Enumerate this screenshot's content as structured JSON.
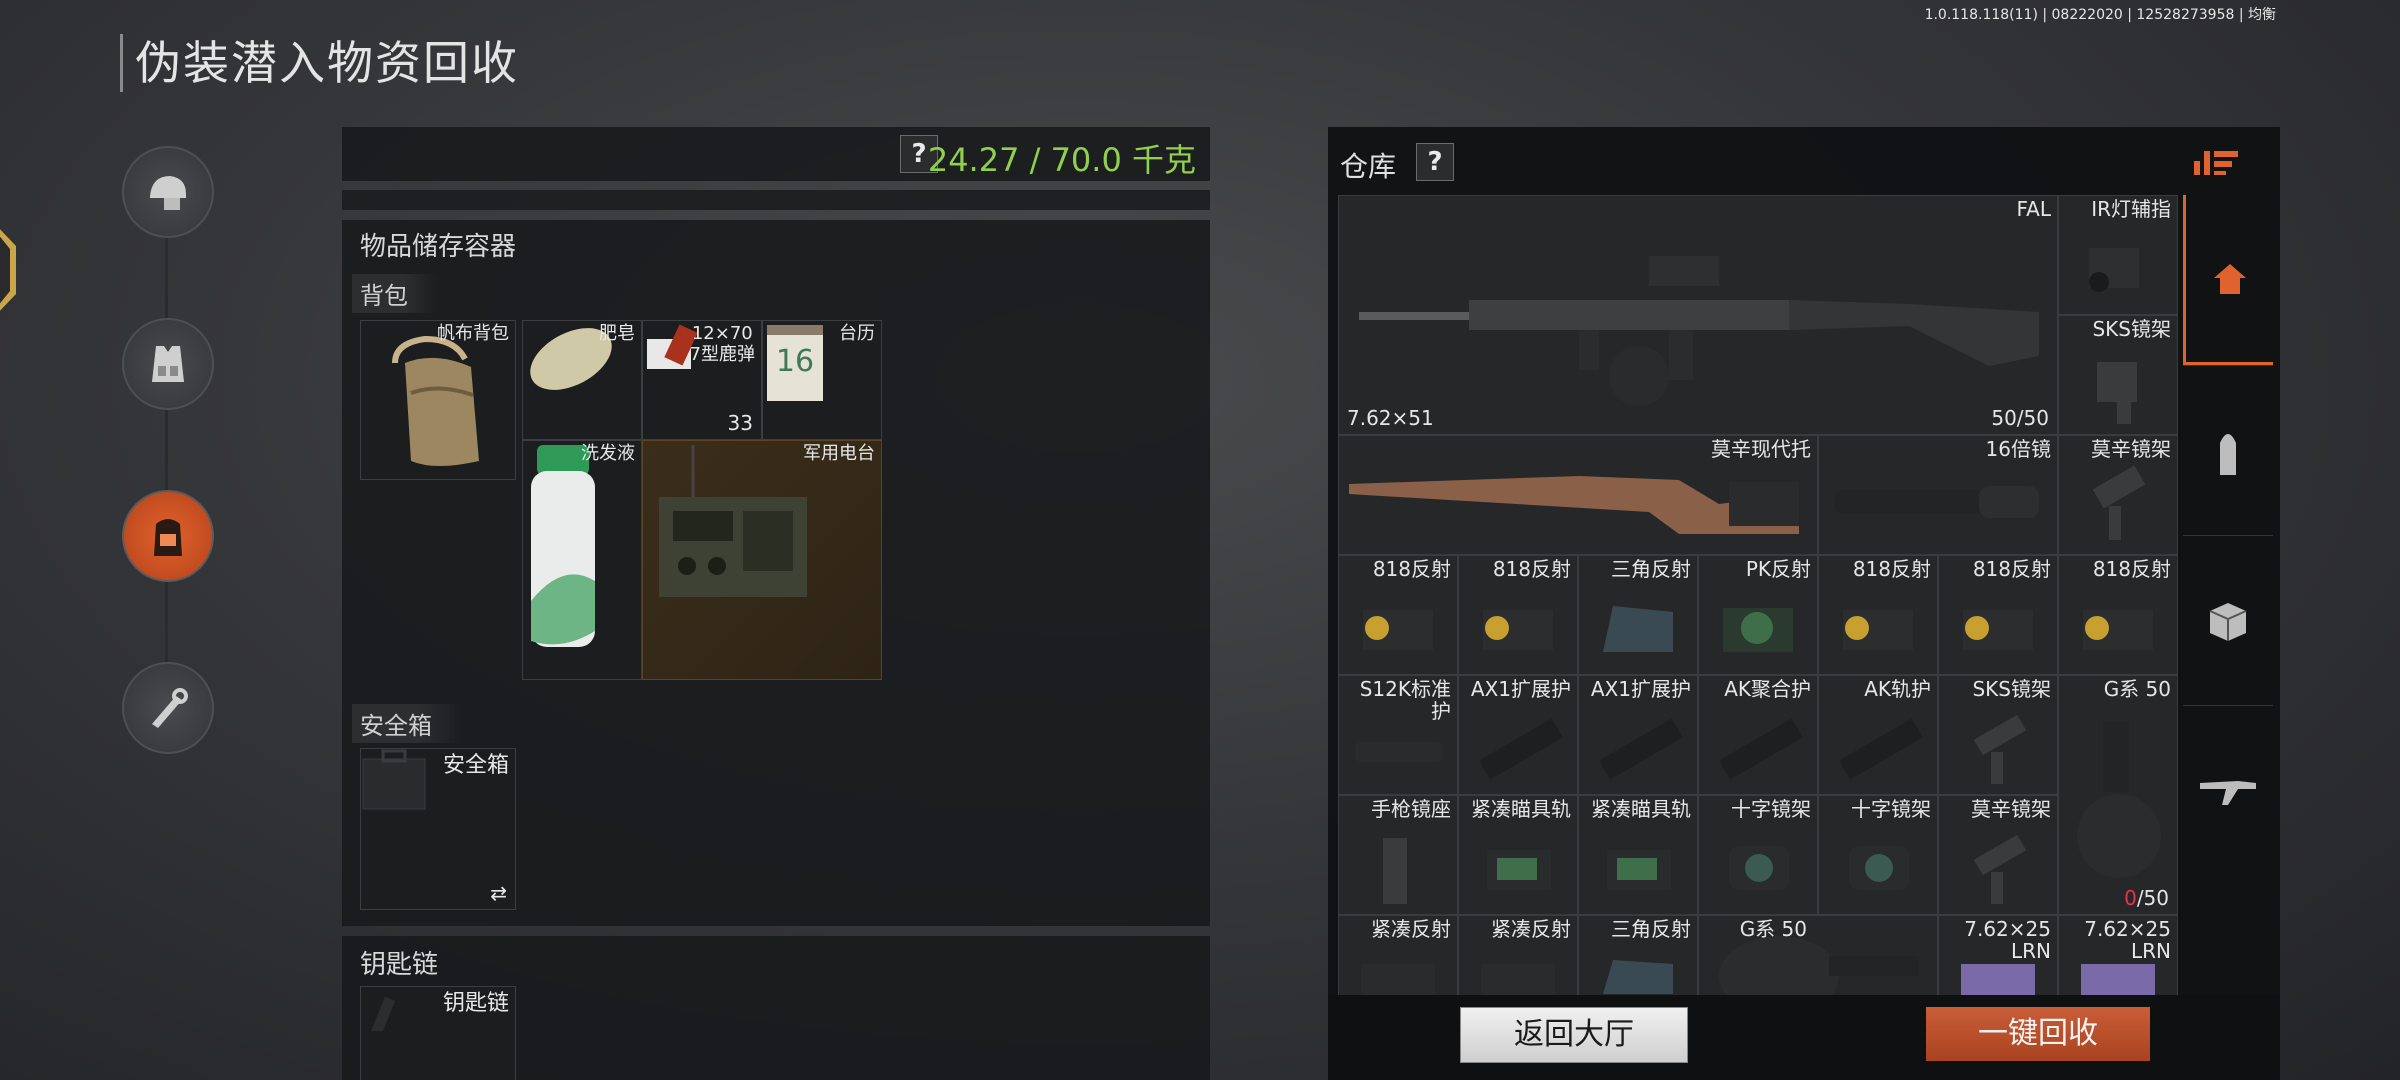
{
  "version": "1.0.118.118(11) | 08222020 | 12528273958 | 均衡",
  "page_title": "伪装潜入物资回收",
  "weight": {
    "help": "?",
    "value": "24.27 / 70.0 千克"
  },
  "storage": {
    "title": "物品储存容器",
    "backpack": {
      "title": "背包",
      "bag_name": "帆布背包",
      "items": [
        {
          "label": "肥皂"
        },
        {
          "label": "12×70\n7型鹿弹",
          "count": "33"
        },
        {
          "label": "台历"
        },
        {
          "label": "洗发液"
        },
        {
          "label": "军用电台"
        }
      ]
    },
    "safebox": {
      "title": "安全箱",
      "slot_label": "安全箱",
      "swap": "⇄"
    },
    "keychain": {
      "title": "钥匙链",
      "slot_label": "钥匙链"
    }
  },
  "warehouse": {
    "title": "仓库",
    "help": "?",
    "cells": {
      "fal": {
        "label": "FAL",
        "caliber": "7.62×51",
        "count": "50/50"
      },
      "ir": "IR灯辅指",
      "sks_mount1": "SKS镜架",
      "moxin_stock": "莫辛现代托",
      "scope16": "16倍镜",
      "moxin_mount1": "莫辛镜架",
      "row3": [
        "818反射",
        "818反射",
        "三角反射",
        "PK反射",
        "818反射",
        "818反射",
        "818反射"
      ],
      "row4": [
        "S12K标准\n护",
        "AX1扩展护",
        "AX1扩展护",
        "AK聚合护",
        "AK轨护",
        "SKS镜架"
      ],
      "drum1": {
        "label": "G系 50",
        "count_red": "0",
        "count_rest": "/50"
      },
      "row5": [
        "手枪镜座",
        "紧凑瞄具轨",
        "紧凑瞄具轨",
        "十字镜架",
        "十字镜架",
        "莫辛镜架"
      ],
      "row6": [
        "紧凑反射",
        "紧凑反射",
        "三角反射",
        "",
        "G系 50",
        "7.62×25\nLRN",
        "7.62×25\nLRN"
      ]
    }
  },
  "buttons": {
    "lobby": "返回大厅",
    "recycle": "一键回收"
  },
  "colors": {
    "weight_green": "#8fd14f",
    "accent_orange": "#e0622e",
    "ammo_red": "#e2334f"
  }
}
